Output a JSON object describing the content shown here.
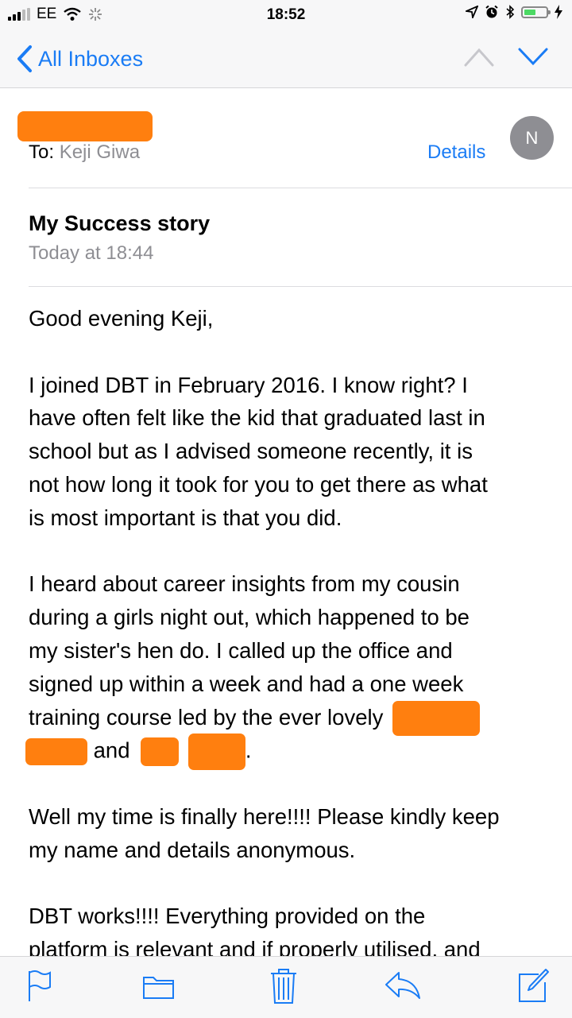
{
  "status_bar": {
    "carrier": "EE",
    "time": "18:52"
  },
  "nav": {
    "back_label": "All Inboxes"
  },
  "header": {
    "to_label": "To:",
    "to_name": "Keji Giwa",
    "details_label": "Details",
    "avatar_initial": "N",
    "subject": "My Success story",
    "date": "Today at 18:44"
  },
  "body": {
    "greeting": "Good evening Keji,",
    "p1": [
      "I joined DBT in February 2016. I know right? I",
      "have often felt like the kid that graduated last in",
      "school but as I advised someone recently, it is",
      "not how long it took for you to get there as what",
      "is most important is that you did."
    ],
    "p2": [
      "I heard about career insights from my cousin",
      "during a girls night out, which happened to be",
      "my sister's hen do. I called up the office and",
      "signed up within a week and had a one week",
      "training course led by the ever lovely"
    ],
    "p2_and": "and",
    "p2_end": ".",
    "p3": [
      "Well my time is finally here!!!! Please kindly keep",
      "my name and details anonymous."
    ],
    "p4": [
      "DBT works!!!! Everything provided on the",
      "platform is relevant and if properly utilised, and"
    ]
  },
  "colors": {
    "accent": "#1a7cf5",
    "redaction": "#ff7f0f",
    "secondary_text": "#8e8e93"
  },
  "toolbar": {
    "icons": [
      "flag-icon",
      "folder-icon",
      "trash-icon",
      "reply-icon",
      "compose-icon"
    ]
  }
}
